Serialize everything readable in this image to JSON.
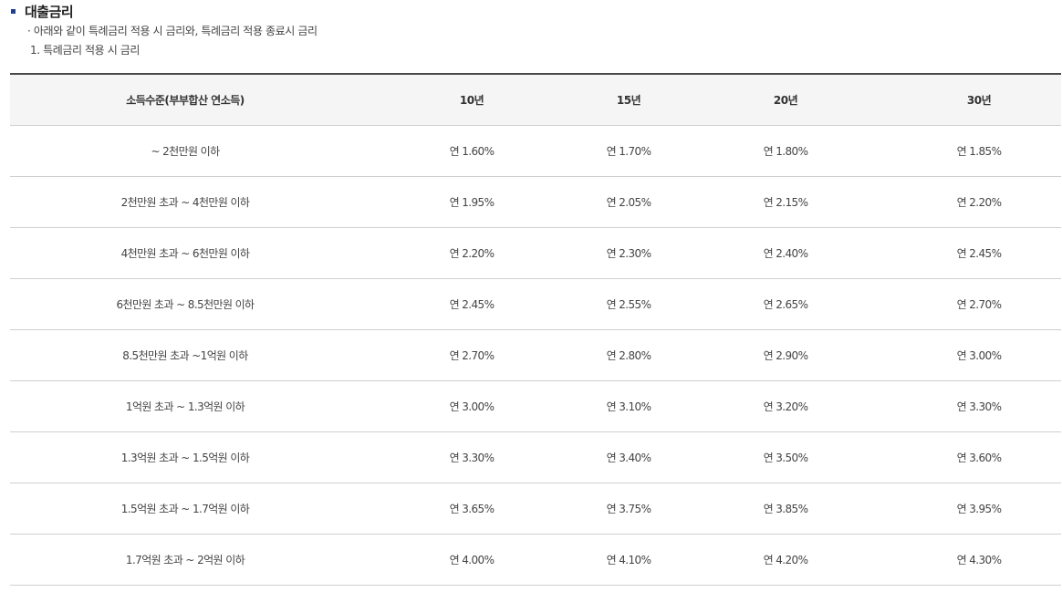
{
  "section": {
    "title": "대출금리",
    "note": "· 아래와 같이 특례금리 적용 시 금리와, 특례금리 적용 종료시 금리",
    "subtitle": "1. 특례금리 적용 시 금리"
  },
  "table": {
    "headers": [
      "소득수준(부부합산 연소득)",
      "10년",
      "15년",
      "20년",
      "30년"
    ],
    "rows": [
      [
        "~ 2천만원 이하",
        "연 1.60%",
        "연 1.70%",
        "연 1.80%",
        "연 1.85%"
      ],
      [
        "2천만원 초과 ~ 4천만원 이하",
        "연 1.95%",
        "연 2.05%",
        "연 2.15%",
        "연 2.20%"
      ],
      [
        "4천만원 초과 ~ 6천만원 이하",
        "연 2.20%",
        "연 2.30%",
        "연 2.40%",
        "연 2.45%"
      ],
      [
        "6천만원 초과 ~ 8.5천만원 이하",
        "연 2.45%",
        "연 2.55%",
        "연 2.65%",
        "연 2.70%"
      ],
      [
        "8.5천만원 초과 ~1억원 이하",
        "연 2.70%",
        "연 2.80%",
        "연 2.90%",
        "연 3.00%"
      ],
      [
        "1억원 초과 ~ 1.3억원 이하",
        "연 3.00%",
        "연 3.10%",
        "연 3.20%",
        "연 3.30%"
      ],
      [
        "1.3억원 초과 ~ 1.5억원 이하",
        "연 3.30%",
        "연 3.40%",
        "연 3.50%",
        "연 3.60%"
      ],
      [
        "1.5억원 초과 ~ 1.7억원 이하",
        "연 3.65%",
        "연 3.75%",
        "연 3.85%",
        "연 3.95%"
      ],
      [
        "1.7억원 초과 ~ 2억원 이하",
        "연 4.00%",
        "연 4.10%",
        "연 4.20%",
        "연 4.30%"
      ]
    ]
  }
}
